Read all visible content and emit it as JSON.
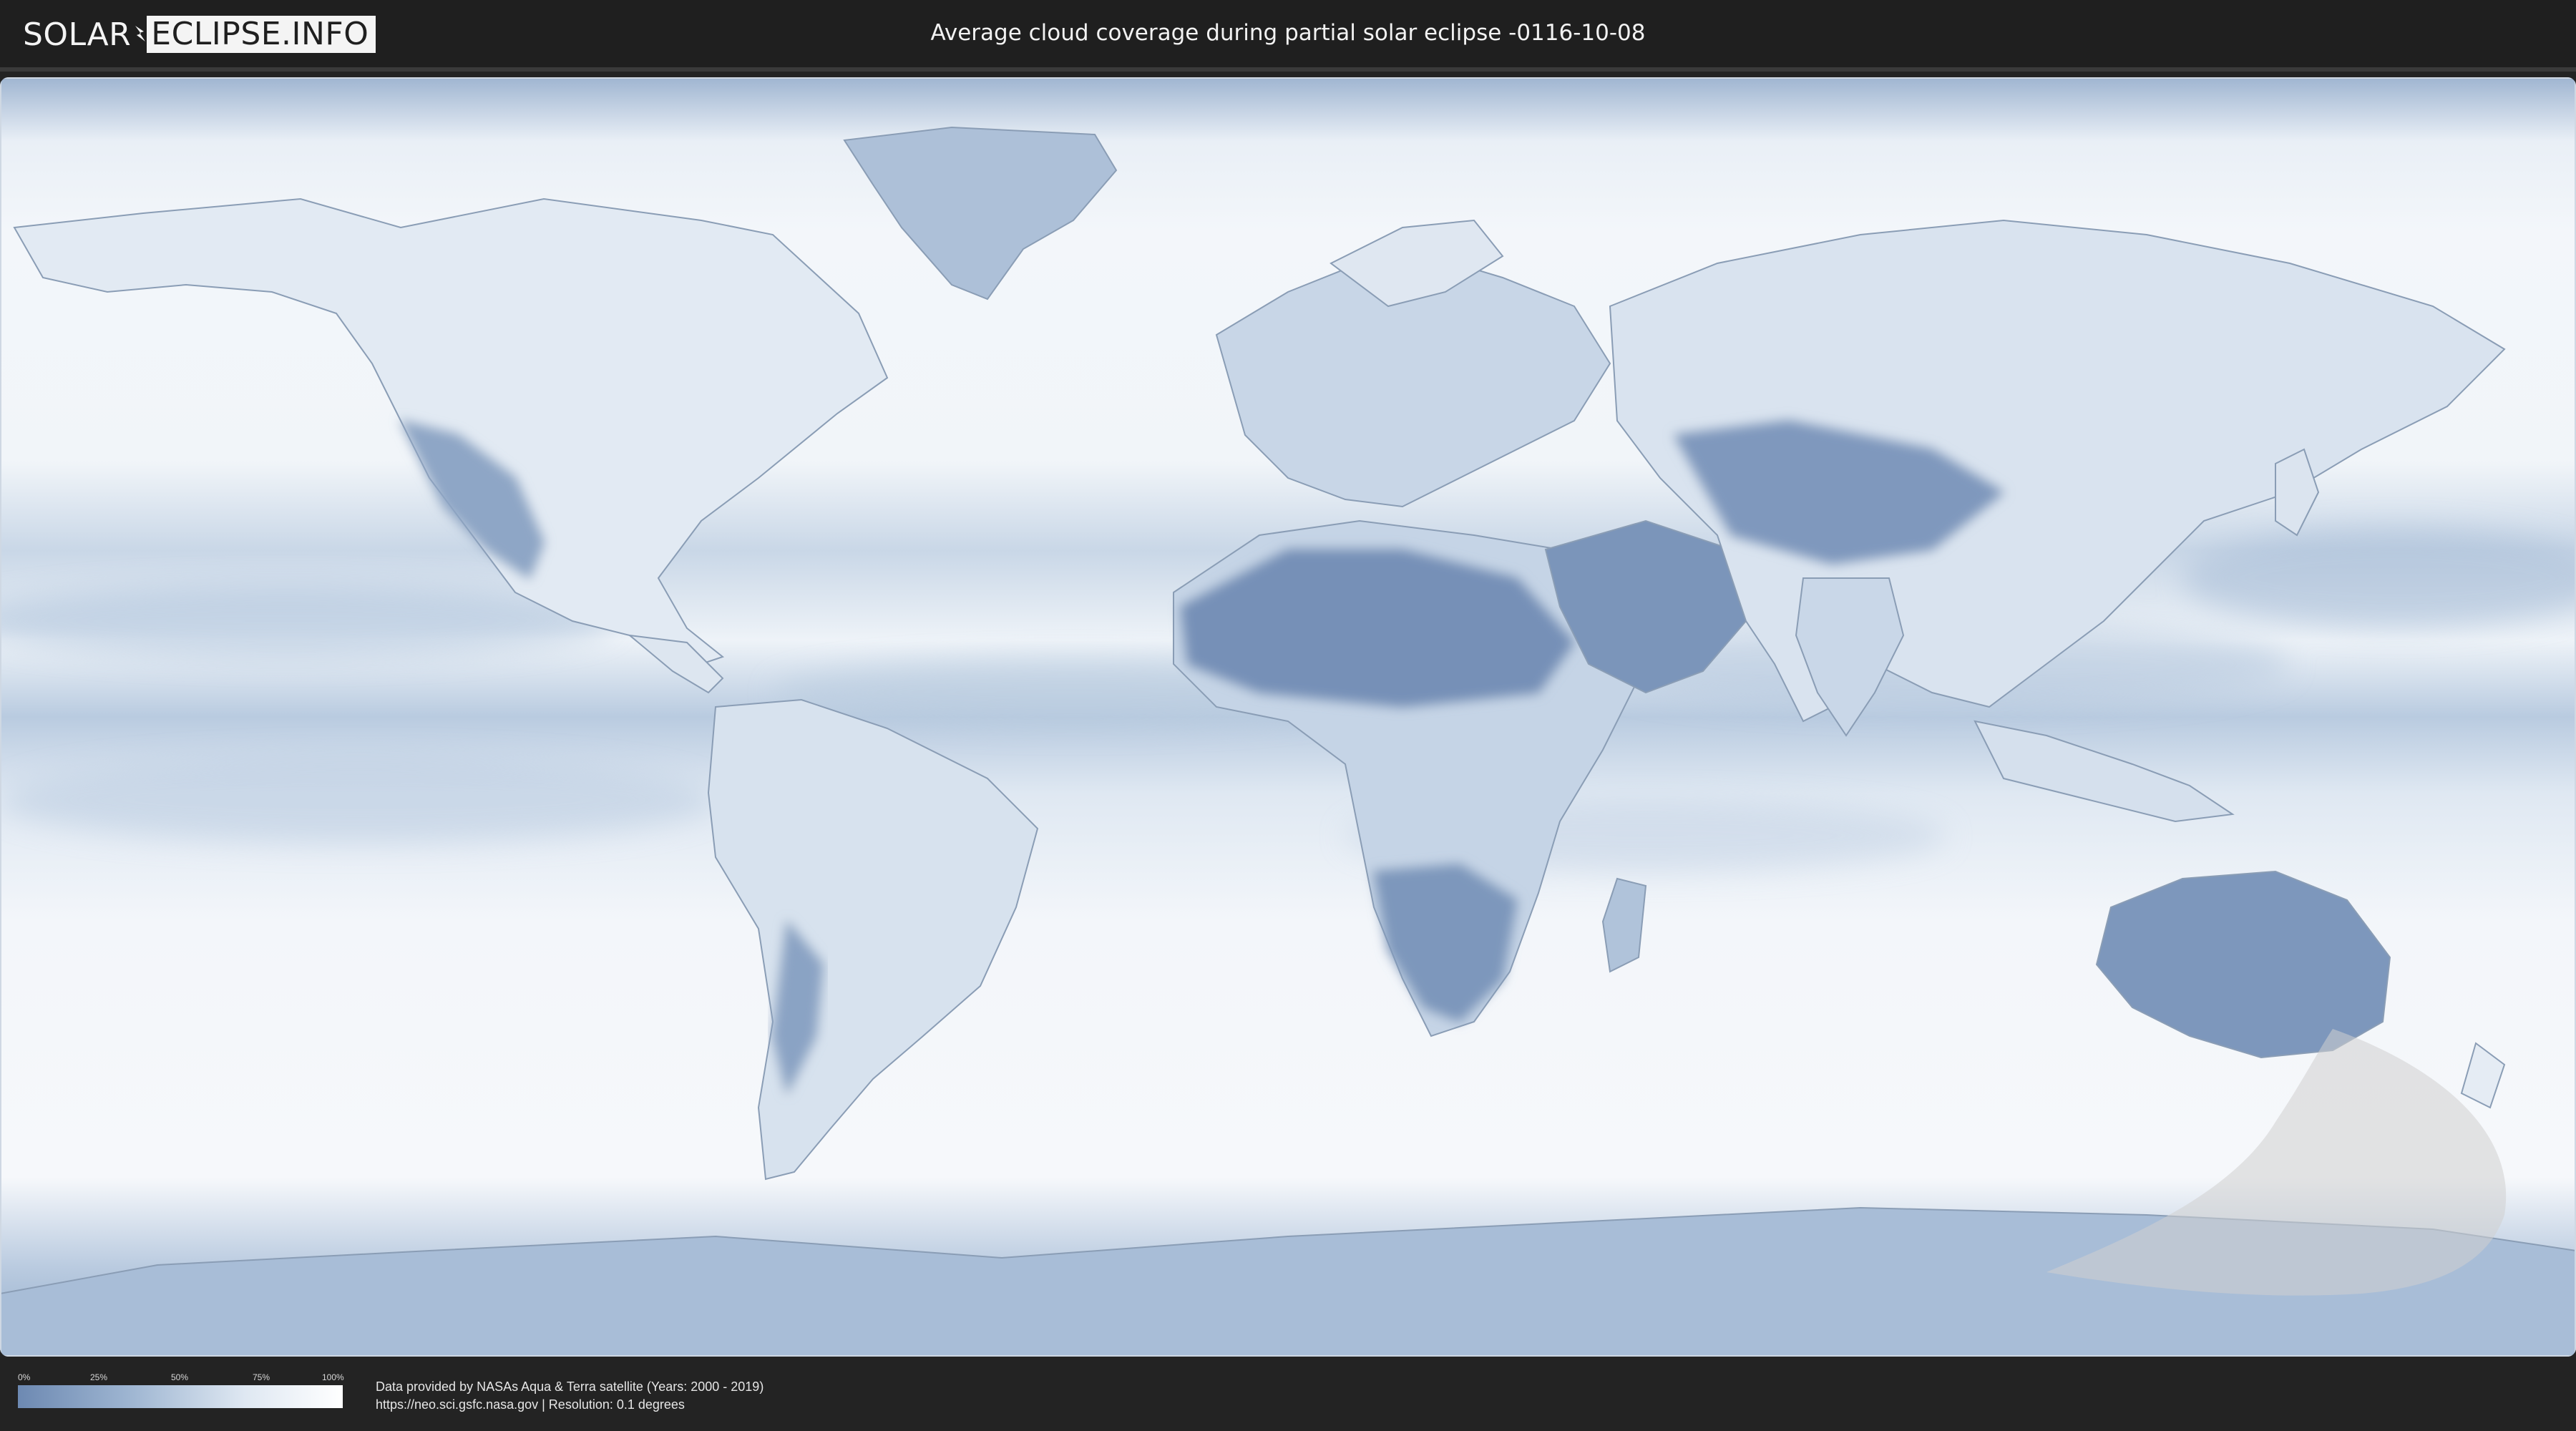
{
  "header": {
    "logo_left": "SOLAR",
    "logo_right": "ECLIPSE.INFO",
    "title": "Average cloud coverage during partial solar eclipse -0116-10-08"
  },
  "legend": {
    "ticks": [
      "0%",
      "25%",
      "50%",
      "75%",
      "100%"
    ],
    "colors": {
      "low": "#6d89b2",
      "high": "#ffffff"
    }
  },
  "credits": {
    "line1": "Data provided by NASAs Aqua & Terra satellite (Years: 2000 - 2019)",
    "line2": "https://neo.sci.gsfc.nasa.gov | Resolution: 0.1 degrees"
  },
  "map": {
    "type": "equirectangular cloud coverage map",
    "eclipse_zone_color": "#c8c8c8"
  }
}
